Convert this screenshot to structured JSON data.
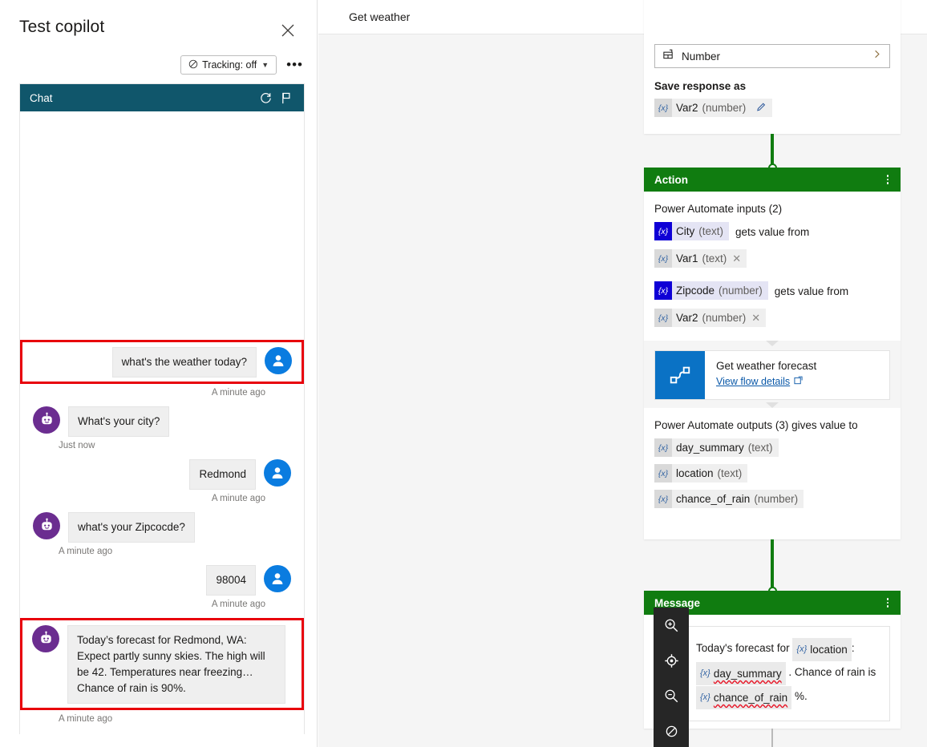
{
  "test_pane": {
    "title": "Test copilot",
    "close_label": "Close",
    "tracking_label": "Tracking: off",
    "more_label": "•••",
    "chat": {
      "header_title": "Chat",
      "messages": [
        {
          "role": "user",
          "text": "what's the weather today?",
          "stamp": "A minute ago",
          "highlighted": true
        },
        {
          "role": "bot",
          "text": "What's your city?",
          "stamp": "Just now",
          "highlighted": false
        },
        {
          "role": "user",
          "text": "Redmond",
          "stamp": "A minute ago",
          "highlighted": false
        },
        {
          "role": "bot",
          "text": "what's your Zipcocde?",
          "stamp": "A minute ago",
          "highlighted": false
        },
        {
          "role": "user",
          "text": "98004",
          "stamp": "A minute ago",
          "highlighted": false
        },
        {
          "role": "bot",
          "text": "Today’s forecast for Redmond, WA: Expect partly sunny skies. The high will be 42. Temperatures near freezing… Chance of rain is 90%.",
          "stamp": "A minute ago",
          "highlighted": true
        }
      ]
    }
  },
  "canvas": {
    "topic_title": "Get weather",
    "question_node": {
      "identity_value": "Number",
      "save_response_label": "Save response as",
      "save_variable": {
        "name": "Var2",
        "type": "(number)"
      }
    },
    "action_node": {
      "title": "Action",
      "inputs_label": "Power Automate inputs (2)",
      "input_bindings": [
        {
          "param": "City",
          "param_type": "(text)",
          "verb": "gets value from",
          "variable": "Var1",
          "variable_type": "(text)"
        },
        {
          "param": "Zipcode",
          "param_type": "(number)",
          "verb": "gets value from",
          "variable": "Var2",
          "variable_type": "(number)"
        }
      ],
      "flow": {
        "name": "Get weather forecast",
        "link_text": "View flow details"
      },
      "outputs_label": "Power Automate outputs (3) gives value to",
      "outputs": [
        {
          "name": "day_summary",
          "type": "(text)"
        },
        {
          "name": "location",
          "type": "(text)"
        },
        {
          "name": "chance_of_rain",
          "type": "(number)"
        }
      ]
    },
    "message_node": {
      "title": "Message",
      "text_before_location": "Today's forecast for",
      "token_location": "location",
      "colon": ":",
      "token_day_summary": "day_summary",
      "text_middle": ". Chance of rain is",
      "token_chance_of_rain": "chance_of_rain",
      "text_end": "%."
    },
    "zoom_toolbar": {
      "buttons": [
        {
          "name": "zoom-in-icon",
          "label": "Zoom in"
        },
        {
          "name": "fit-to-view-icon",
          "label": "Fit to view"
        },
        {
          "name": "zoom-out-icon",
          "label": "Zoom out"
        },
        {
          "name": "reset-zoom-icon",
          "label": "Reset zoom"
        }
      ]
    }
  },
  "colors": {
    "chat_header_teal": "#10566b",
    "node_green": "#107c10",
    "user_avatar_blue": "#0a7ce0",
    "bot_avatar_purple": "#6b2d90",
    "flow_icon_blue": "#0a72c5",
    "highlight_red": "#e8000b",
    "input_chip_blue": "#0f00d6",
    "toolbar_dark": "#262626"
  }
}
